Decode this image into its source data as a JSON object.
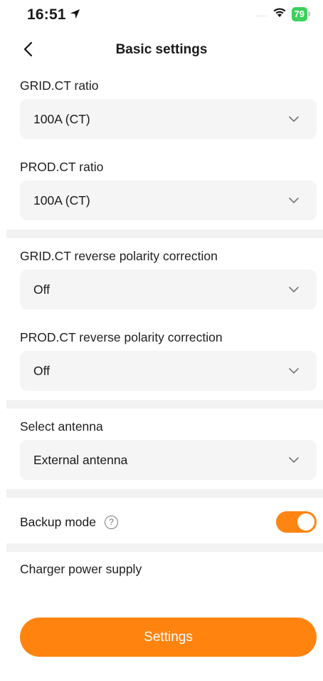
{
  "status_bar": {
    "time": "16:51",
    "battery": "79",
    "signal": "....",
    "icons": [
      "location-arrow-icon",
      "wifi-icon",
      "battery-icon"
    ]
  },
  "nav": {
    "title": "Basic settings",
    "back_icon": "chevron-left-icon"
  },
  "fields": [
    {
      "label": "GRID.CT ratio",
      "value": "100A (CT)"
    },
    {
      "label": "PROD.CT ratio",
      "value": "100A (CT)"
    },
    {
      "label": "GRID.CT reverse polarity correction",
      "value": "Off"
    },
    {
      "label": "PROD.CT reverse polarity correction",
      "value": "Off"
    },
    {
      "label": "Select antenna",
      "value": "External antenna"
    }
  ],
  "backup": {
    "label": "Backup mode",
    "help_icon_text": "?",
    "enabled": true
  },
  "charger": {
    "label": "Charger power supply"
  },
  "primary_button": {
    "label": "Settings"
  },
  "colors": {
    "accent": "#ff840f",
    "field_background": "#f5f5f5",
    "divider": "#f2f2f2",
    "battery": "#3bd15c"
  }
}
